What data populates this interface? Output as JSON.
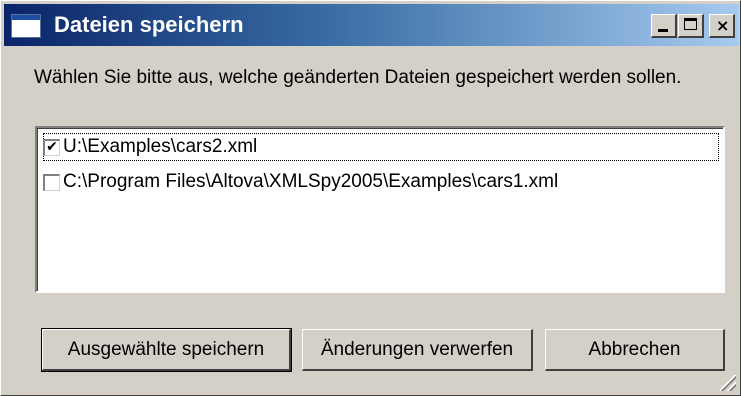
{
  "window": {
    "title": "Dateien speichern",
    "icon": "window-app-icon",
    "controls": {
      "minimize": "_",
      "maximize": "□",
      "close": "×"
    }
  },
  "prompt": "Wählen Sie bitte aus, welche geänderten Dateien gespeichert werden sollen.",
  "file_list": {
    "items": [
      {
        "label": "U:\\Examples\\cars2.xml",
        "checked": true,
        "check_glyph": "✔"
      },
      {
        "label": "C:\\Program Files\\Altova\\XMLSpy2005\\Examples\\cars1.xml",
        "checked": false,
        "check_glyph": ""
      }
    ]
  },
  "buttons": {
    "save_selected": "Ausgewählte speichern",
    "discard_changes": "Änderungen verwerfen",
    "cancel": "Abbrechen"
  },
  "colors": {
    "titlebar_start": "#0a246a",
    "titlebar_end": "#a6caf0",
    "face": "#d4d0c8"
  }
}
